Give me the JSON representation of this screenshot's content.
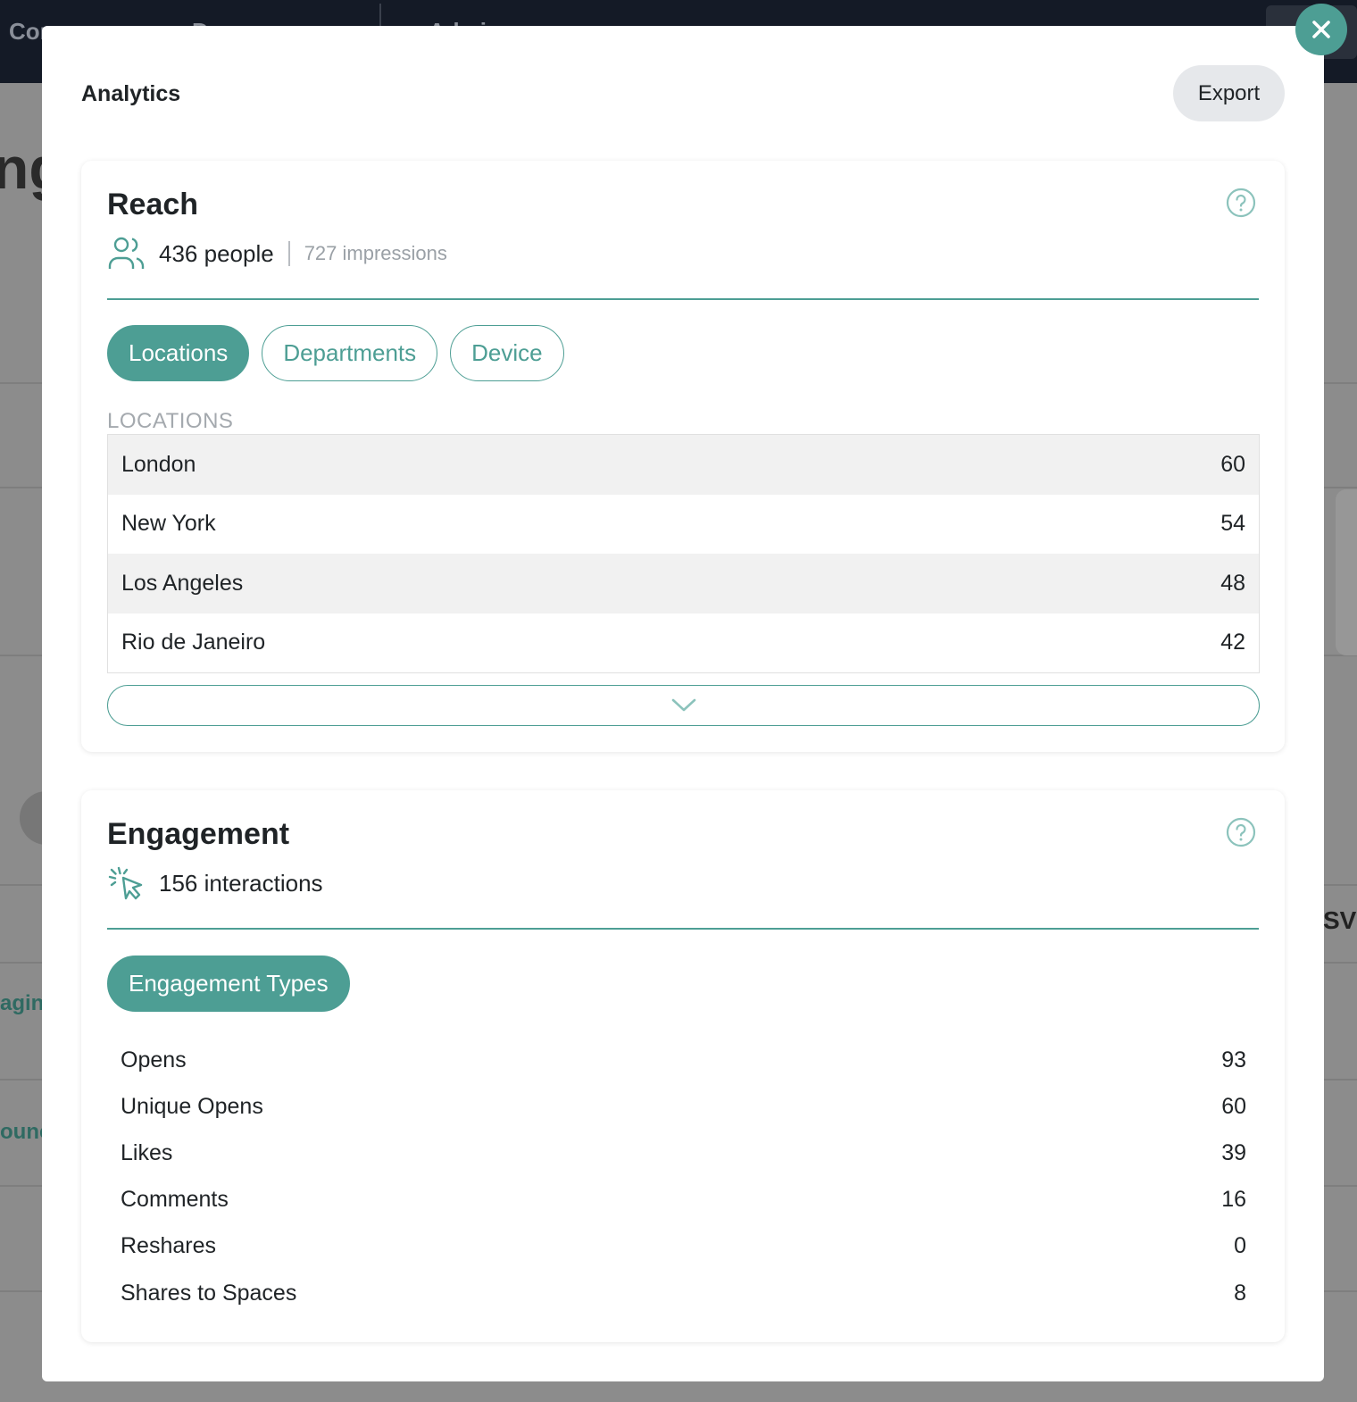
{
  "background": {
    "nav_items": [
      "Cor",
      "D",
      "Admi"
    ],
    "page_heading_fragment": "ng",
    "row_fragment_1": "agin",
    "row_fragment_2": "ounc",
    "column_fragment": "SVI"
  },
  "modal": {
    "title": "Analytics",
    "export_label": "Export",
    "close_icon": "close-icon"
  },
  "reach": {
    "title": "Reach",
    "people": "436 people",
    "impressions": "727 impressions",
    "tabs": [
      {
        "label": "Locations",
        "active": true
      },
      {
        "label": "Departments",
        "active": false
      },
      {
        "label": "Device",
        "active": false
      }
    ],
    "section_label": "LOCATIONS",
    "rows": [
      {
        "name": "London",
        "value": "60"
      },
      {
        "name": "New York",
        "value": "54"
      },
      {
        "name": "Los Angeles",
        "value": "48"
      },
      {
        "name": "Rio de Janeiro",
        "value": "42"
      }
    ]
  },
  "engagement": {
    "title": "Engagement",
    "interactions": "156 interactions",
    "tabs": [
      {
        "label": "Engagement Types",
        "active": true
      }
    ],
    "rows": [
      {
        "name": "Opens",
        "value": "93"
      },
      {
        "name": "Unique Opens",
        "value": "60"
      },
      {
        "name": "Likes",
        "value": "39"
      },
      {
        "name": "Comments",
        "value": "16"
      },
      {
        "name": "Reshares",
        "value": "0"
      },
      {
        "name": "Shares to Spaces",
        "value": "8"
      }
    ]
  },
  "colors": {
    "accent": "#4d9e94",
    "overlay": "#8c8c8c",
    "topbar": "#141a26"
  }
}
